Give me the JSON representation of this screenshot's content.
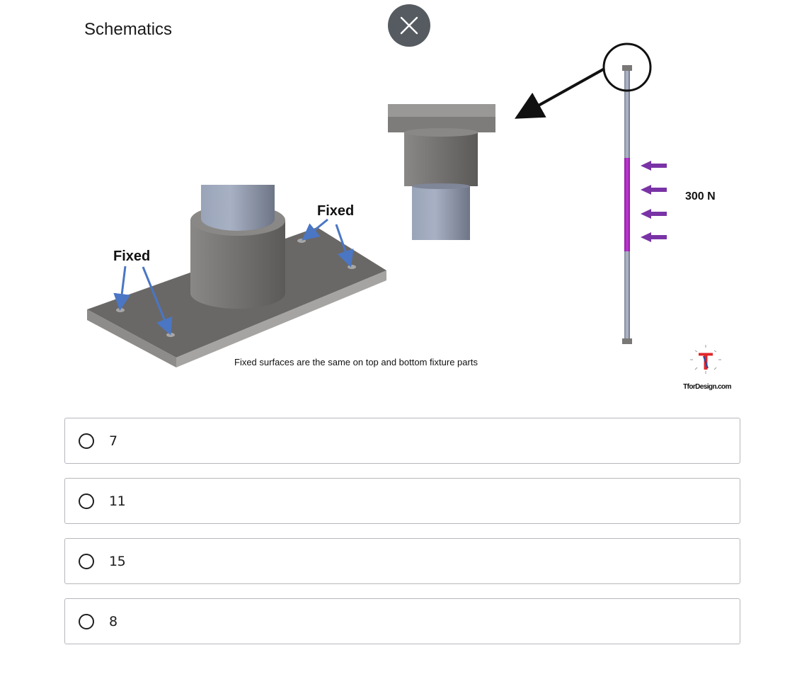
{
  "figure": {
    "title": "Schematics",
    "labels": {
      "fixed_left": "Fixed",
      "fixed_right": "Fixed",
      "load": "300 N",
      "caption": "Fixed surfaces are the same on top and bottom fixture parts",
      "brand": "TforDesign.com",
      "logo_letter": "T"
    },
    "colors": {
      "load_band": "#a020b8",
      "arrows": "#7a33a6",
      "leader_lines": "#4a76c4",
      "logo_red": "#e0262a"
    }
  },
  "close_button": {
    "icon": "close-icon",
    "background": "#555b61"
  },
  "options": [
    {
      "label": "7"
    },
    {
      "label": "11"
    },
    {
      "label": "15"
    },
    {
      "label": "8"
    }
  ]
}
